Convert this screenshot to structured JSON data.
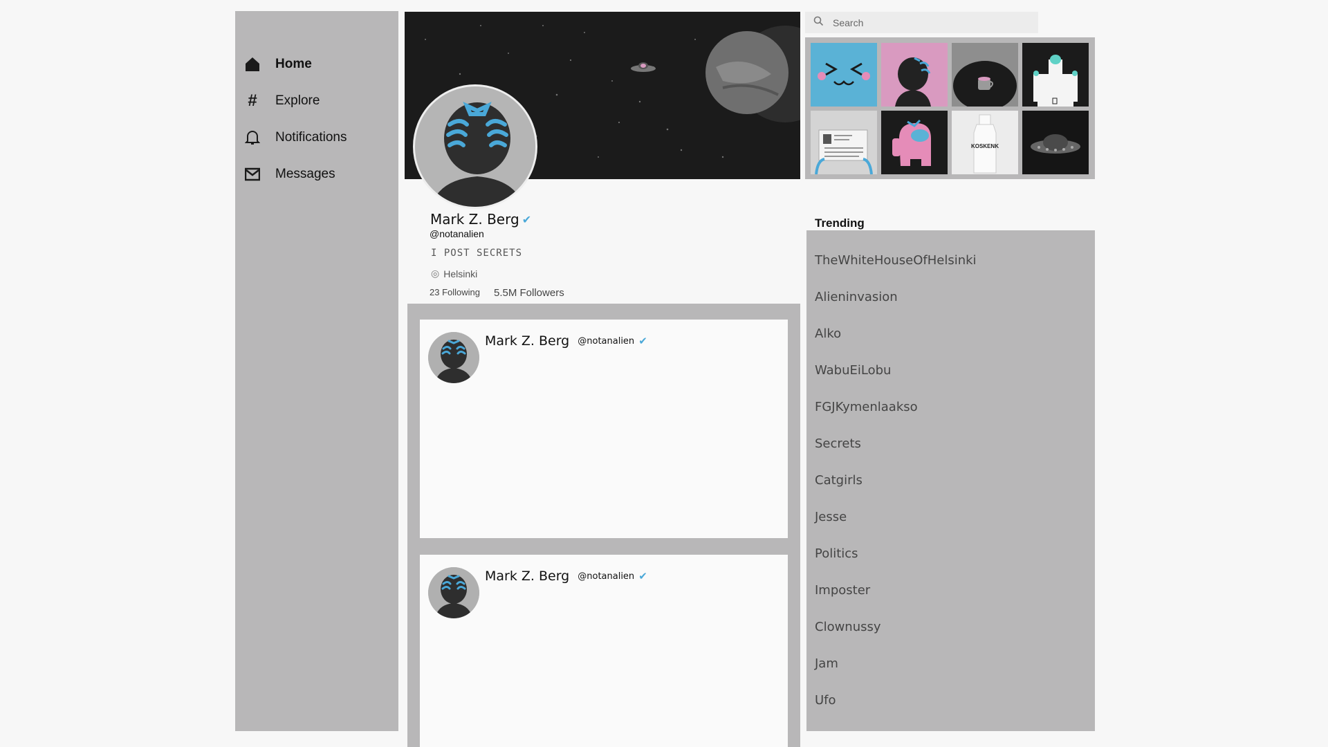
{
  "nav": {
    "items": [
      {
        "label": "Home",
        "icon": "home-icon"
      },
      {
        "label": "Explore",
        "icon": "hashtag-icon"
      },
      {
        "label": "Notifications",
        "icon": "bell-icon"
      },
      {
        "label": "Messages",
        "icon": "envelope-icon"
      }
    ]
  },
  "profile": {
    "name": "Mark Z. Berg",
    "handle": "@notanalien",
    "bio": "I POST SECRETS",
    "location": "Helsinki",
    "following": "23 Following",
    "followers": "5.5M Followers"
  },
  "posts": [
    {
      "name": "Mark Z. Berg",
      "handle": "@notanalien"
    },
    {
      "name": "Mark Z. Berg",
      "handle": "@notanalien"
    }
  ],
  "search": {
    "placeholder": "Search"
  },
  "media": {
    "tile_bottle_text": "KOSKENK"
  },
  "trending": {
    "title": "Trending",
    "items": [
      "TheWhiteHouseOfHelsinki",
      "Alieninvasion",
      "Alko",
      "WabuEiLobu",
      "FGJKymenlaakso",
      "Secrets",
      "Catgirls",
      "Jesse",
      "Politics",
      "Imposter",
      "Clownussy",
      "Jam",
      "Ufo"
    ]
  },
  "colors": {
    "panel_gray": "#b8b7b8",
    "accent_blue": "#4aa8d8",
    "pink": "#d99ac0"
  }
}
